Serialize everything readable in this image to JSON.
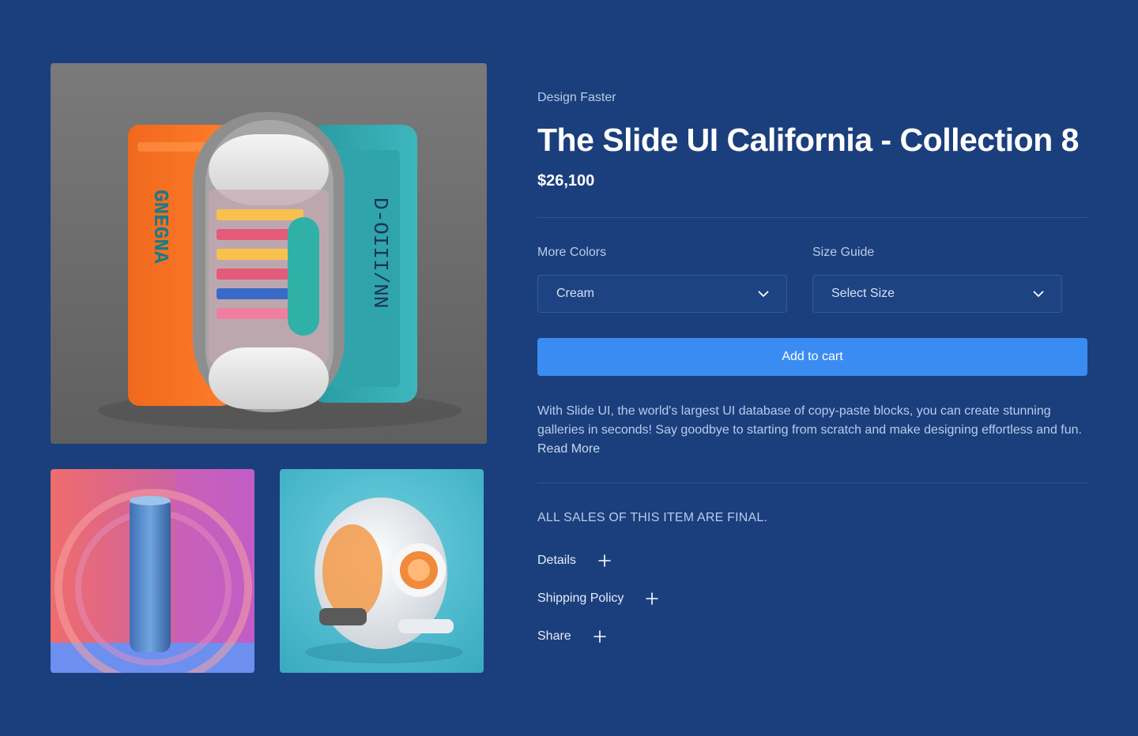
{
  "product": {
    "eyebrow": "Design Faster",
    "title": "The Slide UI California - Collection 8",
    "price": "$26,100"
  },
  "options": {
    "colors_label": "More Colors",
    "colors_value": "Cream",
    "size_label": "Size Guide",
    "size_value": "Select Size"
  },
  "cart": {
    "button_label": "Add to cart"
  },
  "description": {
    "text": "With Slide UI, the world's largest UI database of copy-paste blocks, you can create stunning galleries in seconds! Say goodbye to starting from scratch and make designing effortless and fun.",
    "read_more": "Read More"
  },
  "policy": {
    "final_note": "ALL SALES OF THIS ITEM ARE FINAL."
  },
  "accordion": [
    {
      "label": "Details"
    },
    {
      "label": "Shipping Policy"
    },
    {
      "label": "Share"
    }
  ],
  "images": {
    "main_text_left": "GNEGNA",
    "main_text_right": "D-OIII/NN"
  },
  "colors": {
    "background": "#1b3f7d",
    "accent": "#3b8cf2",
    "muted_text": "#b9cbea"
  },
  "icons": {
    "select_chevron": "chevron-down-icon",
    "accordion_toggle": "plus-icon"
  }
}
